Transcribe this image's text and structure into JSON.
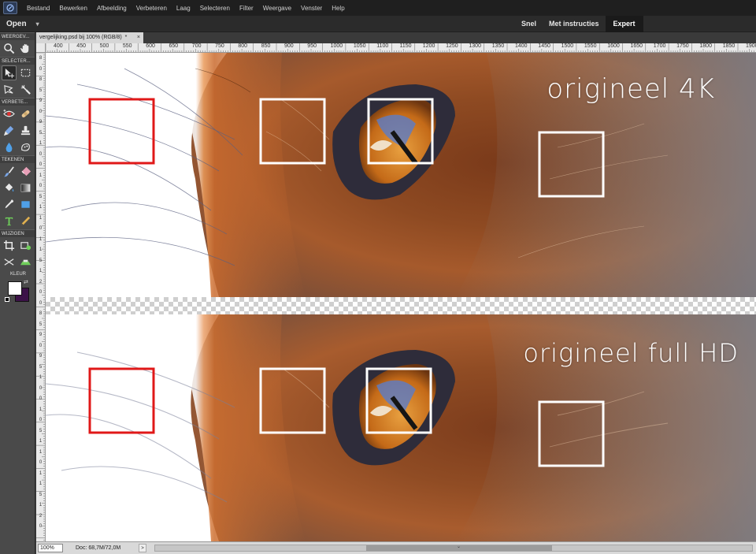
{
  "menubar": {
    "items": [
      "Bestand",
      "Bewerken",
      "Afbeelding",
      "Verbeteren",
      "Laag",
      "Selecteren",
      "Filter",
      "Weergave",
      "Venster",
      "Help"
    ]
  },
  "modebar": {
    "open_label": "Open",
    "tabs": [
      "Snel",
      "Met instructies",
      "Expert"
    ],
    "active_tab": "Expert"
  },
  "toolbox": {
    "sections": {
      "view": "WEERGEV...",
      "select": "SELECTER...",
      "enhance": "VERBETE...",
      "draw": "TEKENEN",
      "modify": "WIJZIGEN",
      "color": "KLEUR"
    },
    "colors": {
      "foreground": "#ffffff",
      "background": "#3c1248"
    }
  },
  "document": {
    "tab_title": "vergelijking.psd bij 100% (RGB/8)",
    "modified_marker": "*",
    "close_glyph": "×"
  },
  "ruler": {
    "top_labels": [
      "400",
      "450",
      "500",
      "550",
      "600",
      "650",
      "700",
      "750",
      "800",
      "850",
      "900",
      "950",
      "1000",
      "1050",
      "1100",
      "1150",
      "1200",
      "1250",
      "1300",
      "1350",
      "1400",
      "1450",
      "1500",
      "1550",
      "1600",
      "1650",
      "1700",
      "1750",
      "1800",
      "1850",
      "1900"
    ],
    "left_labels": [
      "8",
      "0",
      "8",
      "5",
      "9",
      "0",
      "9",
      "5",
      "1",
      "0",
      "0",
      "1",
      "0",
      "5",
      "1",
      "1",
      "0",
      "1",
      "1",
      "5",
      "1",
      "2",
      "0",
      "0",
      "8",
      "5",
      "9",
      "0",
      "9",
      "5",
      "1",
      "0",
      "0",
      "1",
      "0",
      "5",
      "1",
      "1",
      "0",
      "1",
      "1",
      "5",
      "1",
      "2",
      "0"
    ]
  },
  "canvas": {
    "top_label": "origineel 4K",
    "bottom_label": "origineel full HD",
    "highlight_colors": {
      "red": "#e01818",
      "white": "#ffffff"
    }
  },
  "statusbar": {
    "zoom": "100%",
    "doc_info": "Doc: 68,7M/72,0M",
    "arrow": ">"
  }
}
